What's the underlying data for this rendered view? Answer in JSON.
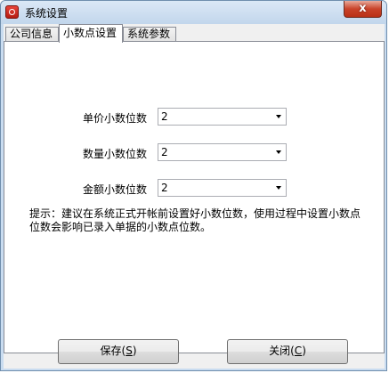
{
  "window": {
    "title": "系统设置",
    "close_glyph": "x"
  },
  "tabs": [
    {
      "label": "公司信息",
      "active": false
    },
    {
      "label": "小数点设置",
      "active": true
    },
    {
      "label": "系统参数",
      "active": false
    }
  ],
  "fields": [
    {
      "label": "单价小数位数",
      "value": "2"
    },
    {
      "label": "数量小数位数",
      "value": "2"
    },
    {
      "label": "金额小数位数",
      "value": "2"
    }
  ],
  "hint": "提示：建议在系统正式开帐前设置好小数位数，使用过程中设置小数点位数会影响已录入单据的小数点位数。",
  "buttons": {
    "save": {
      "text": "保存(",
      "mnemonic": "S",
      "suffix": ")"
    },
    "close": {
      "text": "关闭(",
      "mnemonic": "C",
      "suffix": ")"
    }
  },
  "colors": {
    "title_bar": "#c9dcf0",
    "close_button": "#c9432a"
  }
}
